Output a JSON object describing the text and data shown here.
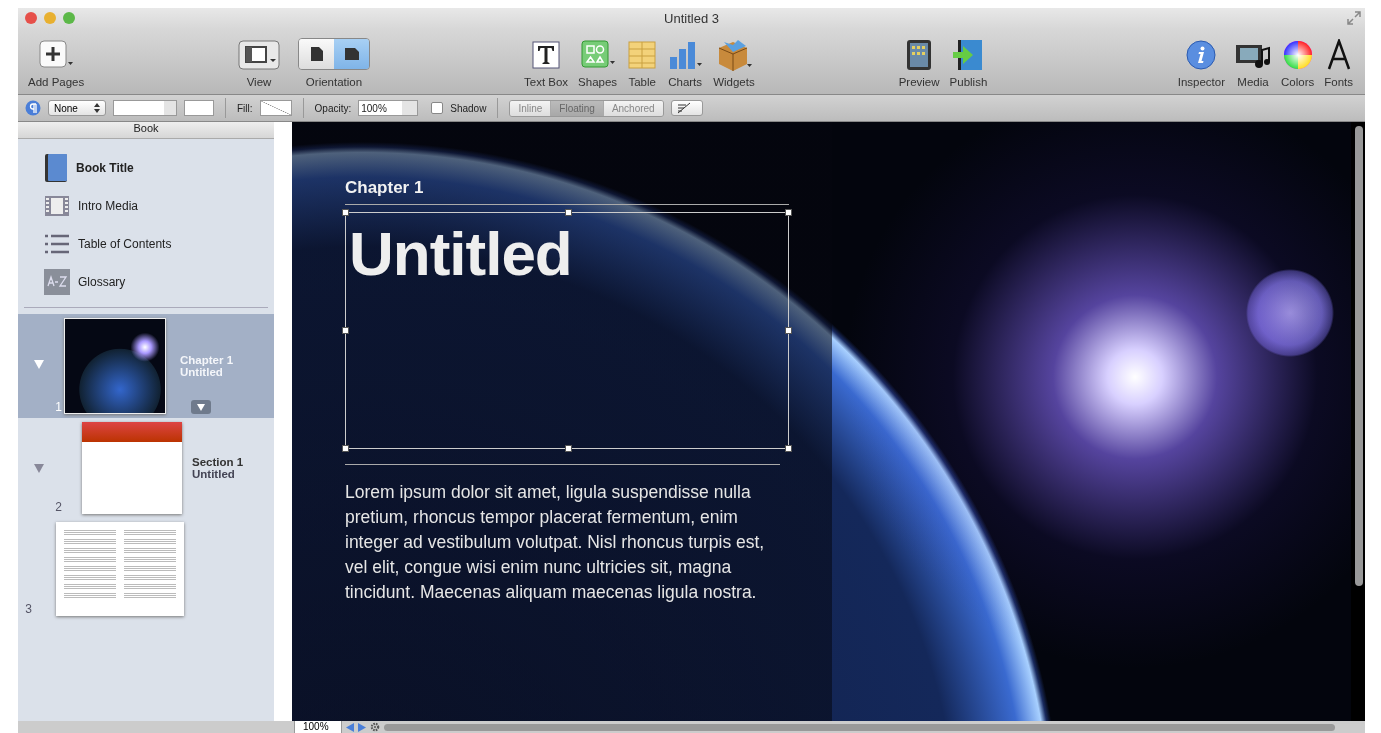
{
  "window": {
    "title": "Untitled 3"
  },
  "toolbar": {
    "left": [
      {
        "label": "Add Pages"
      }
    ],
    "view": {
      "label": "View"
    },
    "orientation": {
      "label": "Orientation",
      "segments": [
        {
          "selected": false
        },
        {
          "selected": true
        }
      ]
    },
    "insert": [
      {
        "label": "Text Box"
      },
      {
        "label": "Shapes"
      },
      {
        "label": "Table"
      },
      {
        "label": "Charts"
      },
      {
        "label": "Widgets"
      }
    ],
    "book": [
      {
        "label": "Preview"
      },
      {
        "label": "Publish"
      }
    ],
    "panels": [
      {
        "label": "Inspector"
      },
      {
        "label": "Media"
      },
      {
        "label": "Colors"
      },
      {
        "label": "Fonts"
      }
    ]
  },
  "format_bar": {
    "style_popup": "None",
    "fill_label": "Fill:",
    "opacity_label": "Opacity:",
    "opacity_value": "100%",
    "shadow": {
      "label": "Shadow",
      "checked": false
    },
    "wrap": [
      {
        "label": "Inline",
        "selected": false
      },
      {
        "label": "Floating",
        "selected": true
      },
      {
        "label": "Anchored",
        "selected": false
      }
    ]
  },
  "sidebar": {
    "title": "Book",
    "items": [
      {
        "label": "Book Title"
      },
      {
        "label": "Intro Media"
      },
      {
        "label": "Table of Contents"
      },
      {
        "label": "Glossary"
      }
    ],
    "pages": [
      {
        "number": "1",
        "title": "Chapter 1",
        "subtitle": "Untitled",
        "selected": true,
        "expanded": true,
        "kind": "chapter"
      },
      {
        "number": "2",
        "title": "Section 1",
        "subtitle": "Untitled",
        "selected": false,
        "expanded": true,
        "kind": "section"
      },
      {
        "number": "3",
        "selected": false,
        "kind": "page"
      }
    ]
  },
  "page": {
    "chapter": "Chapter 1",
    "title": "Untitled",
    "body": "Lorem ipsum dolor sit amet, ligula suspendisse nulla pretium, rhoncus tempor placerat fermentum, enim integer ad vestibulum volutpat. Nisl rhoncus turpis est, vel elit, congue wisi enim nunc ultricies sit, magna tincidunt. Maecenas aliquam maecenas ligula nostra."
  },
  "bottom_bar": {
    "zoom": "100%"
  }
}
